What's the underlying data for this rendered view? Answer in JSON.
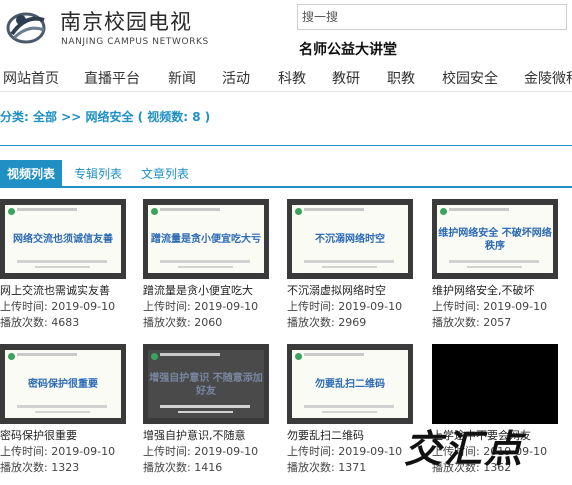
{
  "header": {
    "site_name_cn": "南京校园电视",
    "site_name_en": "NANJING CAMPUS NETWORKS",
    "search_placeholder": "搜一搜",
    "headline": "名师公益大讲堂"
  },
  "nav": {
    "items": [
      "网站首页",
      "直播平台",
      "新闻",
      "活动",
      "科教",
      "教研",
      "职教",
      "校园安全",
      "金陵微种"
    ]
  },
  "breadcrumb": "分类: 全部 >> 网络安全 ( 视频数: 8 )",
  "tabs": [
    "视频列表",
    "专辑列表",
    "文章列表"
  ],
  "labels": {
    "upload_time_label": "上传时间: ",
    "plays_label": "播放次数: "
  },
  "videos": [
    {
      "title": "网上交流也需诚实友善",
      "thumb_title": "网络交流也须诚信友善",
      "upload_time": "2019-09-10",
      "plays": "4683"
    },
    {
      "title": "蹭流量是贪小便宜吃大",
      "thumb_title": "蹭流量是贪小便宜吃大亏",
      "upload_time": "2019-09-10",
      "plays": "2060"
    },
    {
      "title": "不沉溺虚拟网络时空",
      "thumb_title": "不沉溺网络时空",
      "upload_time": "2019-09-10",
      "plays": "2969"
    },
    {
      "title": "维护网络安全,不破坏",
      "thumb_title": "维护网络安全 不破坏网络秩序",
      "upload_time": "2019-09-10",
      "plays": "2057"
    },
    {
      "title": "密码保护很重要",
      "thumb_title": "密码保护很重要",
      "upload_time": "2019-09-10",
      "plays": "1323"
    },
    {
      "title": "增强自护意识,不随意",
      "thumb_title": "增强自护意识 不随意添加好友",
      "upload_time": "2019-09-10",
      "plays": "1416"
    },
    {
      "title": "勿要乱扫二维码",
      "thumb_title": "勿要乱扫二维码",
      "upload_time": "2019-09-10",
      "plays": "1371"
    },
    {
      "title": "上学途中不要会网友",
      "thumb_title": "",
      "upload_time": "2019-09-10",
      "plays": "1362"
    }
  ],
  "watermark": "交汇点",
  "colors": {
    "accent": "#1f8fc4",
    "thumb_text": "#2b6ab4"
  }
}
